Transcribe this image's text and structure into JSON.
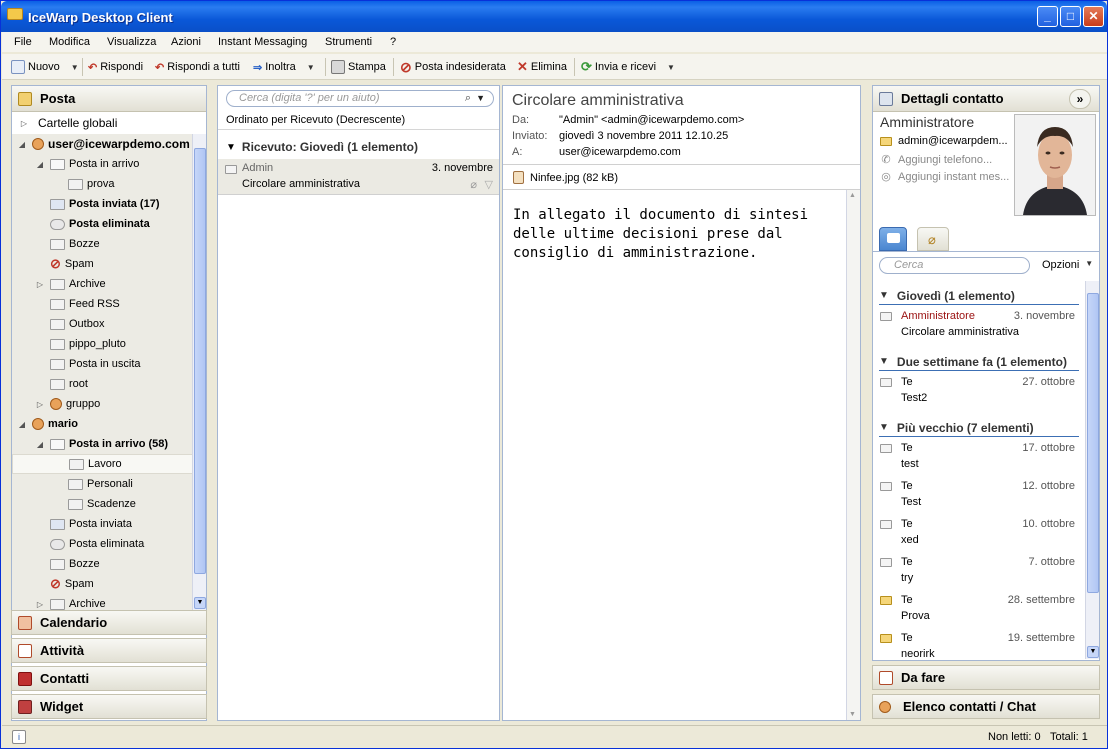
{
  "window": {
    "title": "IceWarp Desktop Client",
    "minimize": "_",
    "maximize": "□",
    "close": "✕"
  },
  "menu": [
    "File",
    "Modifica",
    "Visualizza",
    "Azioni",
    "Instant Messaging",
    "Strumenti",
    "?"
  ],
  "toolbar": {
    "new": "Nuovo",
    "reply": "Rispondi",
    "reply_all": "Rispondi a tutti",
    "forward": "Inoltra",
    "print": "Stampa",
    "spam": "Posta indesiderata",
    "delete": "Elimina",
    "send_receive": "Invia e ricevi"
  },
  "left": {
    "title": "Posta",
    "global": "Cartelle globali",
    "tree": [
      {
        "label": "user@icewarpdemo.com",
        "bold": true,
        "exp": "◢",
        "type": "user"
      },
      {
        "label": "Posta in arrivo",
        "exp": "◢",
        "type": "inbox"
      },
      {
        "label": "prova",
        "type": "folder"
      },
      {
        "label": "Posta inviata (17)",
        "bold": true,
        "type": "sent"
      },
      {
        "label": "Posta eliminata",
        "bold": true,
        "type": "trash"
      },
      {
        "label": "Bozze",
        "type": "drafts"
      },
      {
        "label": "Spam",
        "type": "spam"
      },
      {
        "label": "Archive",
        "exp": "▷",
        "type": "folder"
      },
      {
        "label": "Feed RSS",
        "type": "folder"
      },
      {
        "label": "Outbox",
        "type": "folder"
      },
      {
        "label": "pippo_pluto",
        "type": "folder"
      },
      {
        "label": "Posta in uscita",
        "type": "folder"
      },
      {
        "label": "root",
        "type": "folder"
      },
      {
        "label": "gruppo",
        "exp": "▷",
        "type": "user"
      },
      {
        "label": "mario",
        "bold": true,
        "exp": "◢",
        "type": "user"
      },
      {
        "label": "Posta in arrivo (58)",
        "bold": true,
        "exp": "◢",
        "type": "inbox"
      },
      {
        "label": "Lavoro",
        "type": "folder",
        "selected": true
      },
      {
        "label": "Personali",
        "type": "folder"
      },
      {
        "label": "Scadenze",
        "type": "folder"
      },
      {
        "label": "Posta inviata",
        "type": "sent"
      },
      {
        "label": "Posta eliminata",
        "type": "trash"
      },
      {
        "label": "Bozze",
        "type": "drafts"
      },
      {
        "label": "Spam",
        "type": "spam"
      },
      {
        "label": "Archive",
        "exp": "▷",
        "type": "folder"
      }
    ],
    "nav": [
      "Calendario",
      "Attività",
      "Contatti",
      "Widget"
    ]
  },
  "list": {
    "search_placeholder": "Cerca (digita '?' per un aiuto)",
    "sort": "Ordinato per Ricevuto (Decrescente)",
    "group": "Ricevuto: Giovedì  (1 elemento)",
    "message": {
      "from": "Admin",
      "date": "3. novembre",
      "subject": "Circolare amministrativa"
    }
  },
  "reading": {
    "subject": "Circolare amministrativa",
    "from_label": "Da:",
    "from": "\"Admin\" <admin@icewarpdemo.com>",
    "sent_label": "Inviato:",
    "sent": "giovedì 3 novembre 2011 12.10.25",
    "to_label": "A:",
    "to": "user@icewarpdemo.com",
    "attachment": "Ninfee.jpg (82 kB)",
    "body": "In allegato il documento di sintesi delle ultime decisioni prese dal consiglio di amministrazione."
  },
  "contact": {
    "title": "Dettagli contatto",
    "name": "Amministratore",
    "email": "admin@icewarpdem...",
    "add_phone": "Aggiungi telefono...",
    "add_im": "Aggiungi instant mes...",
    "search_placeholder": "Cerca",
    "options": "Opzioni",
    "groups": [
      {
        "title": "Giovedì  (1 elemento)",
        "items": [
          {
            "from": "Amministratore",
            "date": "3. novembre",
            "subject": "Circolare amministrativa",
            "red": true
          }
        ]
      },
      {
        "title": "Due settimane fa  (1 elemento)",
        "items": [
          {
            "from": "Te",
            "date": "27. ottobre",
            "subject": "Test2"
          }
        ]
      },
      {
        "title": "Più vecchio  (7 elementi)",
        "items": [
          {
            "from": "Te",
            "date": "17. ottobre",
            "subject": "test"
          },
          {
            "from": "Te",
            "date": "12. ottobre",
            "subject": "Test"
          },
          {
            "from": "Te",
            "date": "10. ottobre",
            "subject": "xed"
          },
          {
            "from": "Te",
            "date": "7. ottobre",
            "subject": "try"
          },
          {
            "from": "Te",
            "date": "28. settembre",
            "subject": "Prova",
            "yellow": true
          },
          {
            "from": "Te",
            "date": "19. settembre",
            "subject": "neorirk",
            "yellow": true
          }
        ]
      }
    ],
    "todo": "Da fare",
    "chat": "Elenco contatti / Chat"
  },
  "status": {
    "unread": "Non letti: 0",
    "total": "Totali: 1"
  },
  "colors": {
    "accent": "#0a58d8",
    "group_line": "#3c6fb4",
    "red_text": "#9a1010"
  }
}
